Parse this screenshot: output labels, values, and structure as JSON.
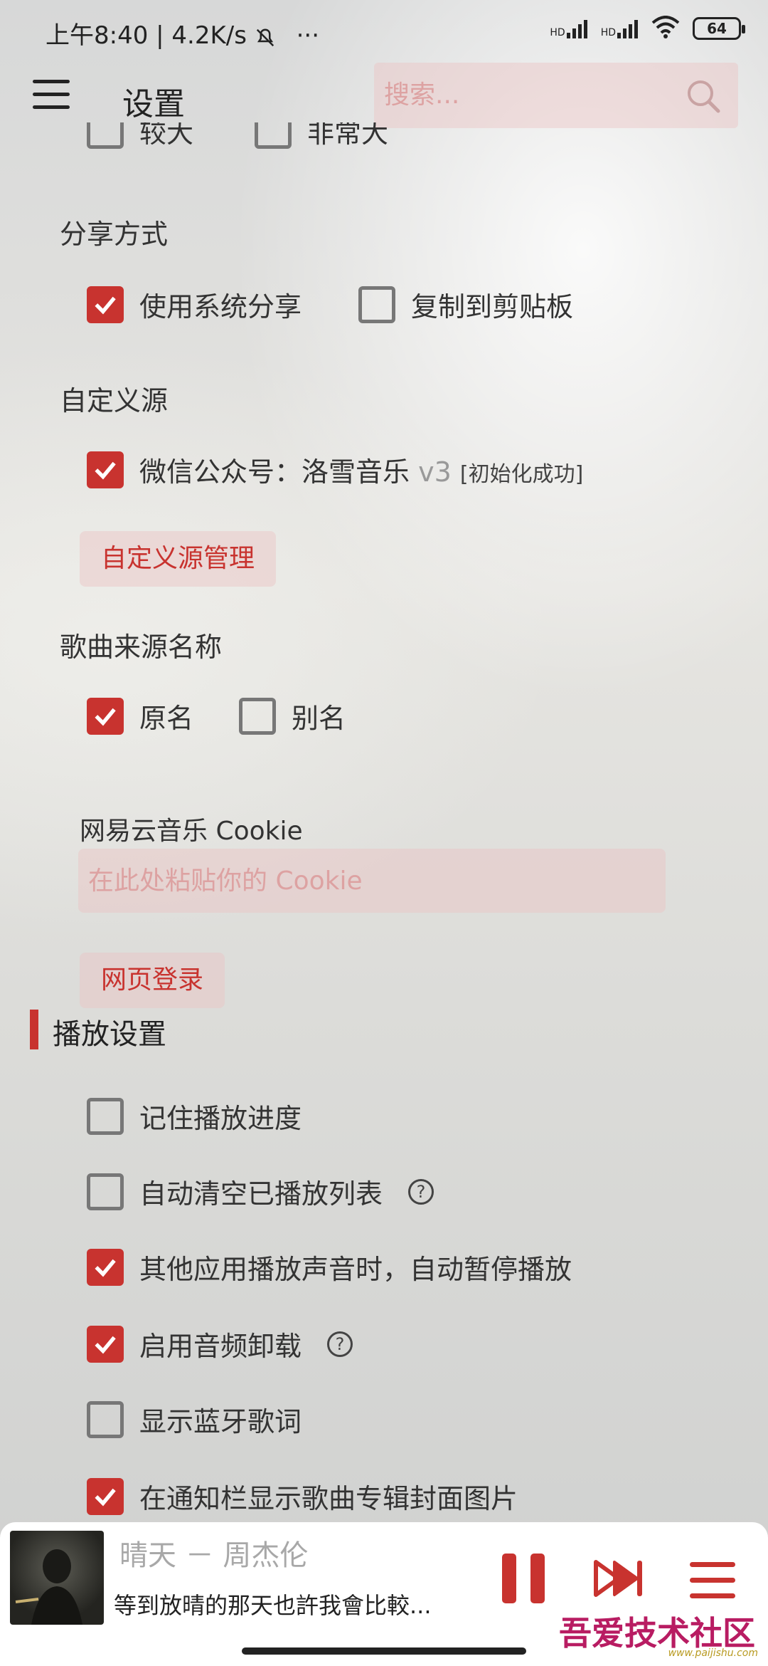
{
  "status_bar": {
    "time": "上午8:40 | 4.2K/s",
    "more": "···",
    "network1": "HD",
    "network2": "HD",
    "battery": "64"
  },
  "header": {
    "title": "设置",
    "search_placeholder": "搜索..."
  },
  "partial_options": [
    "较大",
    "非常大"
  ],
  "share": {
    "title": "分享方式",
    "options": [
      {
        "label": "使用系统分享",
        "checked": true
      },
      {
        "label": "复制到剪贴板",
        "checked": false
      }
    ]
  },
  "custom_source": {
    "title": "自定义源",
    "item_label": "微信公众号：洛雪音乐",
    "item_version": "v3",
    "item_status": "[初始化成功]",
    "item_checked": true,
    "manage_button": "自定义源管理"
  },
  "song_source_name": {
    "title": "歌曲来源名称",
    "options": [
      {
        "label": "原名",
        "checked": true
      },
      {
        "label": "别名",
        "checked": false
      }
    ]
  },
  "netease_cookie": {
    "label": "网易云音乐 Cookie",
    "placeholder": "在此处粘贴你的 Cookie",
    "login_button": "网页登录"
  },
  "playback": {
    "title": "播放设置",
    "options": [
      {
        "label": "记住播放进度",
        "checked": false,
        "help": false
      },
      {
        "label": "自动清空已播放列表",
        "checked": false,
        "help": true
      },
      {
        "label": "其他应用播放声音时，自动暂停播放",
        "checked": true,
        "help": false
      },
      {
        "label": "启用音频卸载",
        "checked": true,
        "help": true
      },
      {
        "label": "显示蓝牙歌词",
        "checked": false,
        "help": false
      },
      {
        "label": "在通知栏显示歌曲专辑封面图片",
        "checked": true,
        "help": false
      }
    ]
  },
  "player": {
    "title": "晴天 － 周杰伦",
    "lyric": "等到放晴的那天也許我會比較..."
  },
  "watermark": {
    "text": "吾爱技术社区",
    "url": "www.paijishu.com"
  },
  "colors": {
    "accent": "#c8332f",
    "pill_bg": "#ecc4c4"
  }
}
